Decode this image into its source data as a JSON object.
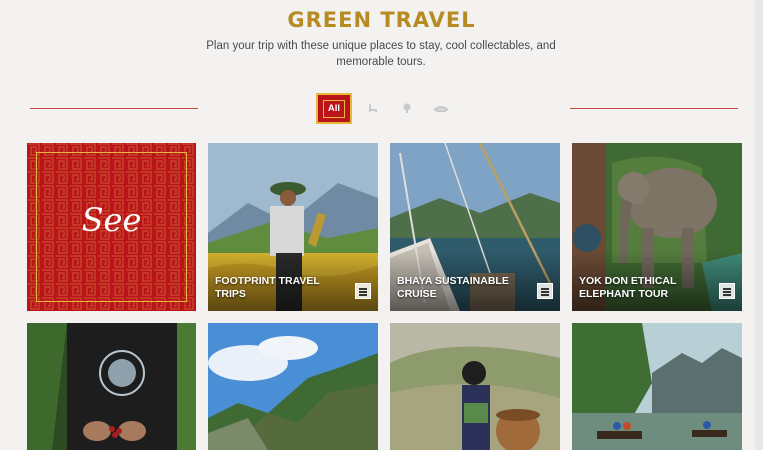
{
  "header": {
    "title": "GREEN TRAVEL",
    "subtitle": "Plan your trip with these unique places to stay, cool collectables, and memorable tours."
  },
  "filters": {
    "all_label": "All",
    "icons": [
      "bed-icon",
      "bag-icon",
      "pin-icon"
    ]
  },
  "grid": {
    "row1": [
      {
        "label": "See",
        "type": "see"
      },
      {
        "label": "FOOTPRINT TRAVEL TRIPS"
      },
      {
        "label": "BHAYA SUSTAINABLE CRUISE"
      },
      {
        "label": "YOK DON ETHICAL ELEPHANT TOUR"
      }
    ]
  },
  "colors": {
    "title": "#b58b22",
    "accent_red": "#b8141a",
    "gold": "#e6b93c",
    "rule": "#c94a3f"
  }
}
